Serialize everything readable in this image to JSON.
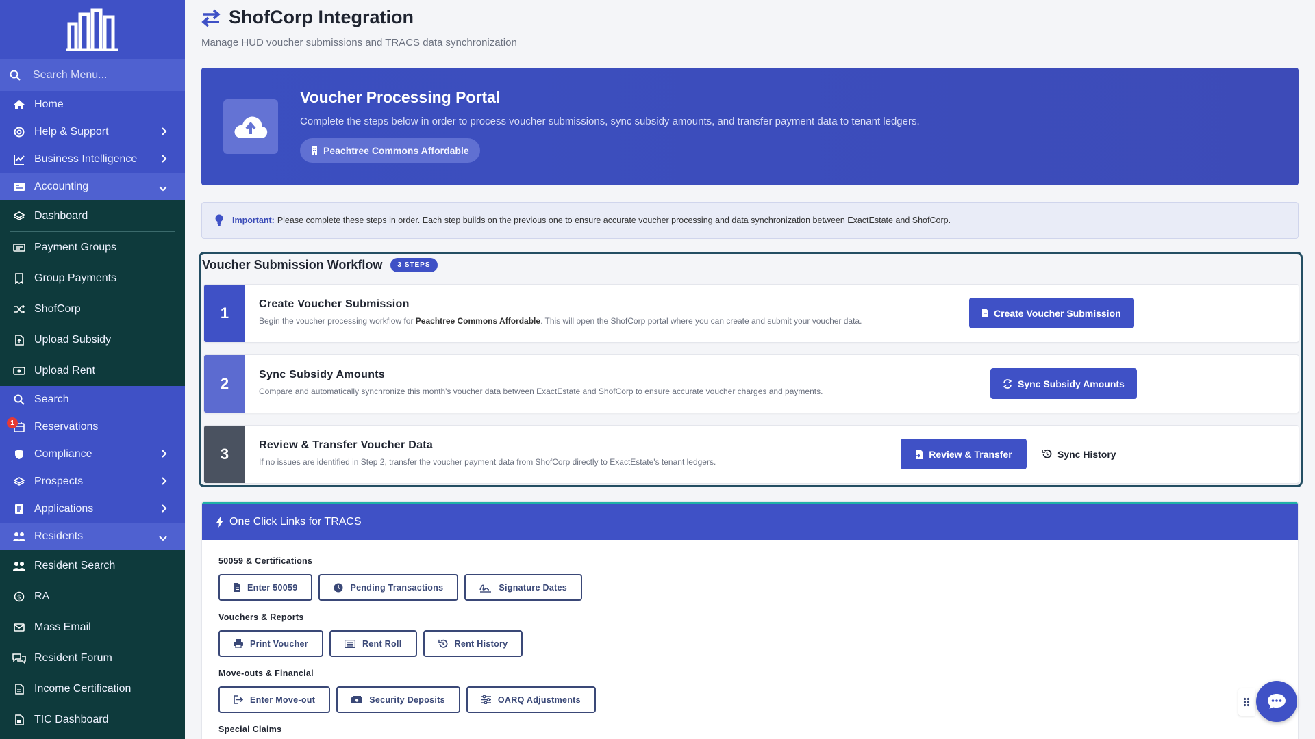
{
  "sidebar": {
    "search_placeholder": "Search Menu...",
    "items": [
      {
        "label": "Home",
        "icon": "home-icon"
      },
      {
        "label": "Help & Support",
        "icon": "lifebuoy-icon"
      },
      {
        "label": "Business Intelligence",
        "icon": "chart-line-icon"
      },
      {
        "label": "Accounting",
        "icon": "ledger-icon"
      },
      {
        "label": "Dashboard",
        "icon": "layers-icon"
      },
      {
        "label": "Payment Groups",
        "icon": "money-group-icon"
      },
      {
        "label": "Group Payments",
        "icon": "receipt-icon"
      },
      {
        "label": "ShofCorp",
        "icon": "shuffle-icon"
      },
      {
        "label": "Upload Subsidy",
        "icon": "file-upload-icon"
      },
      {
        "label": "Upload Rent",
        "icon": "cash-icon"
      },
      {
        "label": "Search",
        "icon": "search-icon"
      },
      {
        "label": "Reservations",
        "icon": "calendar-icon",
        "badge": "1"
      },
      {
        "label": "Compliance",
        "icon": "shield-icon"
      },
      {
        "label": "Prospects",
        "icon": "layers-icon"
      },
      {
        "label": "Applications",
        "icon": "document-icon"
      },
      {
        "label": "Residents",
        "icon": "users-icon"
      },
      {
        "label": "Resident Search",
        "icon": "users-icon"
      },
      {
        "label": "RA",
        "icon": "dollar-circle-icon"
      },
      {
        "label": "Mass Email",
        "icon": "mail-icon"
      },
      {
        "label": "Resident Forum",
        "icon": "comments-icon"
      },
      {
        "label": "Income Certification",
        "icon": "file-icon"
      },
      {
        "label": "TIC Dashboard",
        "icon": "dashboard-icon"
      }
    ]
  },
  "header": {
    "title": "ShofCorp Integration",
    "subtitle": "Manage HUD voucher submissions and TRACS data synchronization"
  },
  "hero": {
    "title": "Voucher Processing Portal",
    "description": "Complete the steps below in order to process voucher submissions, sync subsidy amounts, and transfer payment data to tenant ledgers.",
    "property": "Peachtree Commons Affordable"
  },
  "notice": {
    "label": "Important:",
    "text": "Please complete these steps in order. Each step builds on the previous one to ensure accurate voucher processing and data synchronization between ExactEstate and ShofCorp."
  },
  "workflow": {
    "title": "Voucher Submission Workflow",
    "badge": "3 STEPS",
    "steps": [
      {
        "number": "1",
        "title": "Create Voucher Submission",
        "desc_pre": "Begin the voucher processing workflow for",
        "desc_bold": "Peachtree Commons Affordable",
        "desc_post": ". This will open the ShofCorp portal where you can create and submit your voucher data.",
        "button": "Create Voucher Submission",
        "color": "#3f51c6"
      },
      {
        "number": "2",
        "title": "Sync Subsidy Amounts",
        "desc_pre": "Compare and automatically synchronize this month's voucher data between ExactEstate and ShofCorp to ensure accurate voucher charges and payments.",
        "button": "Sync Subsidy Amounts",
        "color": "#5c6bd0"
      },
      {
        "number": "3",
        "title": "Review & Transfer Voucher Data",
        "desc_pre": "If no issues are identified in Step 2, transfer the voucher payment data from ShofCorp directly to ExactEstate's tenant ledgers.",
        "button": "Review & Transfer",
        "secondary": "Sync History",
        "color": "#4a5260"
      }
    ]
  },
  "tracs": {
    "title": "One Click Links for TRACS",
    "groups": [
      {
        "label": "50059 & Certifications",
        "buttons": [
          "Enter 50059",
          "Pending Transactions",
          "Signature Dates"
        ]
      },
      {
        "label": "Vouchers & Reports",
        "buttons": [
          "Print Voucher",
          "Rent Roll",
          "Rent History"
        ]
      },
      {
        "label": "Move-outs & Financial",
        "buttons": [
          "Enter Move-out",
          "Security Deposits",
          "OARQ Adjustments"
        ]
      },
      {
        "label": "Special Claims",
        "buttons": []
      }
    ]
  },
  "colors": {
    "primary": "#3f51c6",
    "sidebar": "#0e3a3c",
    "accent_teal": "#21b0a7"
  }
}
